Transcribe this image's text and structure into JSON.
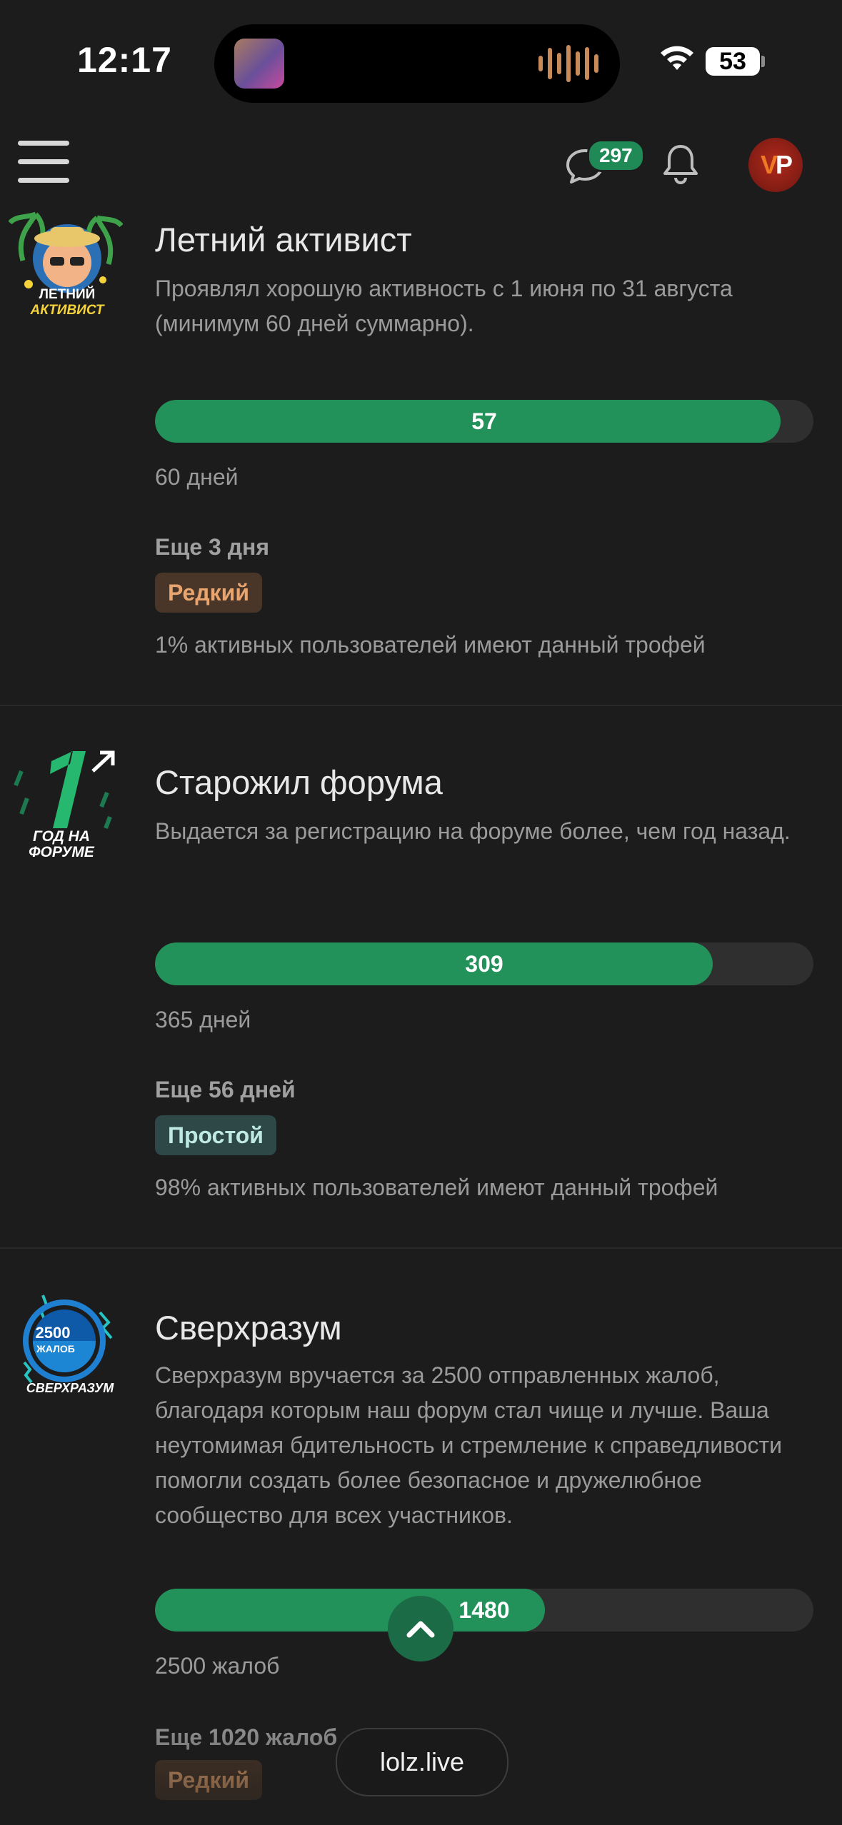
{
  "status_bar": {
    "time": "12:17",
    "battery": "53",
    "battery_level": 0.53
  },
  "header": {
    "chat_badge": "297",
    "avatar_text_left": "V",
    "avatar_text_right": "P"
  },
  "trophies": [
    {
      "icon_text_1": "ЛЕТНИЙ",
      "icon_text_2": "АКТИВИСТ",
      "title": "Летний активист",
      "description": "Проявлял хорошую активность с 1 июня по 31 августа (минимум 60 дней суммарно).",
      "progress_value": "57",
      "progress_fraction": 0.95,
      "goal": "60 дней",
      "remaining": "Еще 3 дня",
      "rarity": "Редкий",
      "share": "1% активных пользователей имеют данный трофей"
    },
    {
      "icon_text_1": "1",
      "icon_text_2": "ГОД НА",
      "icon_text_3": "ФОРУМЕ",
      "title": "Старожил форума",
      "description": "Выдается за регистрацию на форуме более, чем год назад.",
      "progress_value": "309",
      "progress_fraction": 0.8466,
      "goal": "365 дней",
      "remaining": "Еще 56 дней",
      "rarity": "Простой",
      "share": "98% активных пользователей имеют данный трофей"
    },
    {
      "icon_text_1": "2500",
      "icon_text_2": "ЖАЛОБ",
      "icon_text_3": "СВЕРХРАЗУМ",
      "title": "Сверхразум",
      "description": "Сверхразум вручается за 2500 отправленных жалоб, благодаря которым наш форум стал чище и лучше. Ваша неутомимая бдительность и стремление к справедливости помогли создать более безопасное и дружелюбное сообщество для всех участников.",
      "progress_value": "1480",
      "progress_fraction": 0.592,
      "goal": "2500 жалоб",
      "remaining": "Еще 1020 жалоб",
      "rarity": "Редкий"
    }
  ],
  "site_pill": "lolz.live",
  "colors": {
    "accent": "#22925a",
    "background": "#1c1c1c",
    "rare": "#e8a56f",
    "common": "#bfe9e3"
  }
}
